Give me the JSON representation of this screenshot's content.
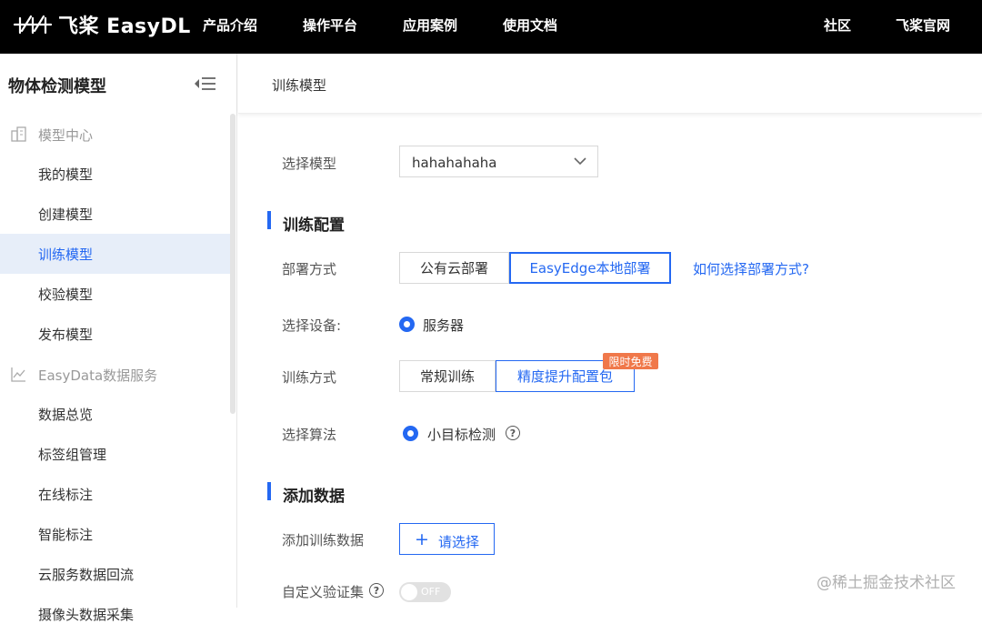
{
  "topbar": {
    "logo_text": "飞桨 EasyDL",
    "nav": [
      "产品介绍",
      "操作平台",
      "应用案例",
      "使用文档"
    ],
    "right_nav": [
      "社区",
      "飞桨官网"
    ]
  },
  "sidebar": {
    "title": "物体检测模型",
    "groups": [
      {
        "label": "模型中心",
        "icon": "building-icon"
      },
      {
        "label": "EasyData数据服务",
        "icon": "chart-icon"
      }
    ],
    "model_items": [
      "我的模型",
      "创建模型",
      "训练模型",
      "校验模型",
      "发布模型"
    ],
    "data_items": [
      "数据总览",
      "标签组管理",
      "在线标注",
      "智能标注",
      "云服务数据回流",
      "摄像头数据采集"
    ],
    "active_item": "训练模型"
  },
  "main": {
    "header_title": "训练模型",
    "select_model": {
      "label": "选择模型",
      "value": "hahahahaha"
    },
    "section_training": "训练配置",
    "deploy": {
      "label": "部署方式",
      "options": [
        "公有云部署",
        "EasyEdge本地部署"
      ],
      "selected": "EasyEdge本地部署",
      "help_link": "如何选择部署方式?"
    },
    "device": {
      "label": "选择设备:",
      "option": "服务器"
    },
    "train_mode": {
      "label": "训练方式",
      "options": [
        "常规训练",
        "精度提升配置包"
      ],
      "selected": "精度提升配置包",
      "badge": "限时免费"
    },
    "algorithm": {
      "label": "选择算法",
      "option": "小目标检测"
    },
    "section_data": "添加数据",
    "add_data": {
      "label": "添加训练数据",
      "button": "请选择"
    },
    "custom_validation": {
      "label": "自定义验证集",
      "toggle": "OFF"
    }
  },
  "watermark": "@稀土掘金技术社区",
  "colors": {
    "accent": "#2468f2",
    "badge": "#f0784a",
    "topbar": "#000000"
  }
}
